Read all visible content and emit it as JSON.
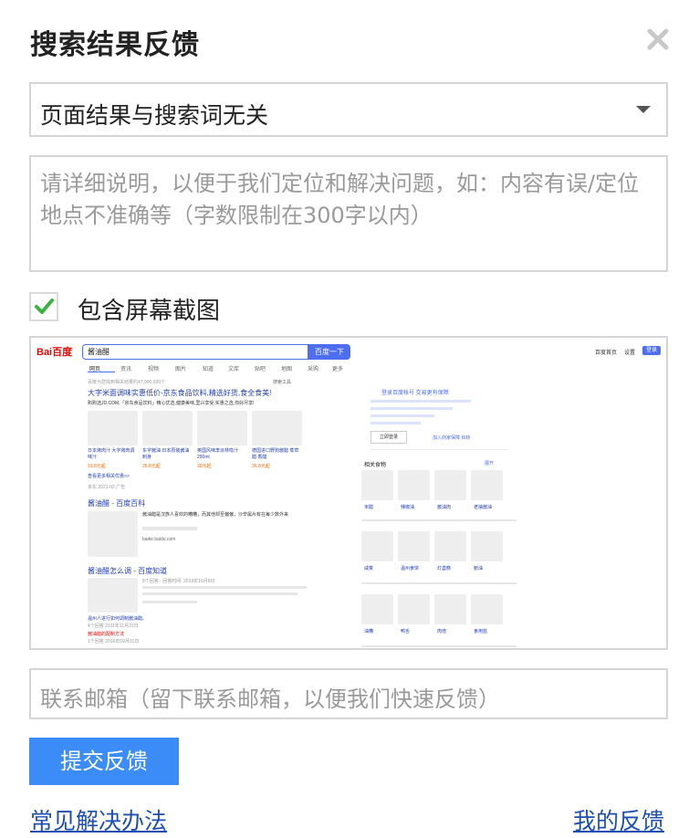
{
  "dialog": {
    "title": "搜索结果反馈",
    "close_icon": "close-icon"
  },
  "reason_select": {
    "value": "页面结果与搜索词无关"
  },
  "detail": {
    "placeholder": "请详细说明，以便于我们定位和解决问题，如：内容有误/定位地点不准确等（字数限制在300字以内）"
  },
  "screenshot_option": {
    "label": "包含屏幕截图",
    "checked": true
  },
  "preview": {
    "logo": "Bai百度",
    "query": "酱油醋",
    "search_button": "百度一下",
    "top_links": [
      "百度首页",
      "设置",
      "登录"
    ],
    "tabs": [
      "网页",
      "资讯",
      "视频",
      "图片",
      "知道",
      "文库",
      "贴吧",
      "地图",
      "采购",
      "更多"
    ],
    "result_count": "百度为您找到相关结果约47,900,000个",
    "search_tools": "搜索工具",
    "ad_title": "大字米面调味实惠低价-京东食品饮料,精选好货,食全食美!",
    "ad_desc": "购购选JD.COM,「京东食品饮料」精心优选,健康美味,里兴享受,实惠之选,你好尽享!",
    "products": [
      {
        "name": "日本烤肉汁 大字烤肉调味汁",
        "price": "31.8元起"
      },
      {
        "name": "东字酱油 日本原装酱油刺身",
        "price": "35.8元起"
      },
      {
        "name": "英国风味李派林喼汁 290ml",
        "price": "39元起"
      },
      {
        "name": "德国进口野狗酱醋 蒸草醋 香醋",
        "price": "36.8元起"
      }
    ],
    "more_products": "查看更多相关优惠>>",
    "ad_meta": "京东  2021-02  广告",
    "baike_title": "酱油醋 - 百度百科",
    "baike_desc": "酱油醋是汉族人喜欢的糟糟，而其他却至偏偏，沙辛属片有在每少数外来",
    "baike_link": "baike.baidu.com",
    "zhidao_title": "酱油醋怎么调 - 百度知道",
    "zhidao_meta": "8个回答 - 回答时间: 2019年10月8日",
    "zhidao_q": "温州人进行如何调制酱油醋。",
    "zhidao_q_meta": "4个回答  2011年11月22日",
    "zhidao_q2": "酱油醋的配制方法",
    "zhidao_q2_meta": "1个回答  2016年09月01日",
    "login_promo": "登录百度帐号 交易更有保障",
    "login_button": "立即登录",
    "join_link": "加入商家保障 目转",
    "related_title": "相关食物",
    "expand": "展开",
    "related_row1": [
      "米醋",
      "辣椒油",
      "酱油肉",
      "老抽酱油"
    ],
    "related_row2": [
      "咸菜",
      "温州食饼",
      "灯盏糕",
      "鲍油"
    ],
    "related_row3": [
      "油糟",
      "鸭舌",
      "肉培",
      "食用盐"
    ]
  },
  "email": {
    "placeholder": "联系邮箱（留下联系邮箱，以便我们快速反馈）"
  },
  "actions": {
    "submit": "提交反馈",
    "faq_link": "常见解决办法",
    "my_feedback_link": "我的反馈"
  },
  "colors": {
    "primary_blue": "#3b8cf6",
    "check_green": "#3cb043",
    "link_blue": "#1d4fb0",
    "baidu_red": "#e10601"
  }
}
